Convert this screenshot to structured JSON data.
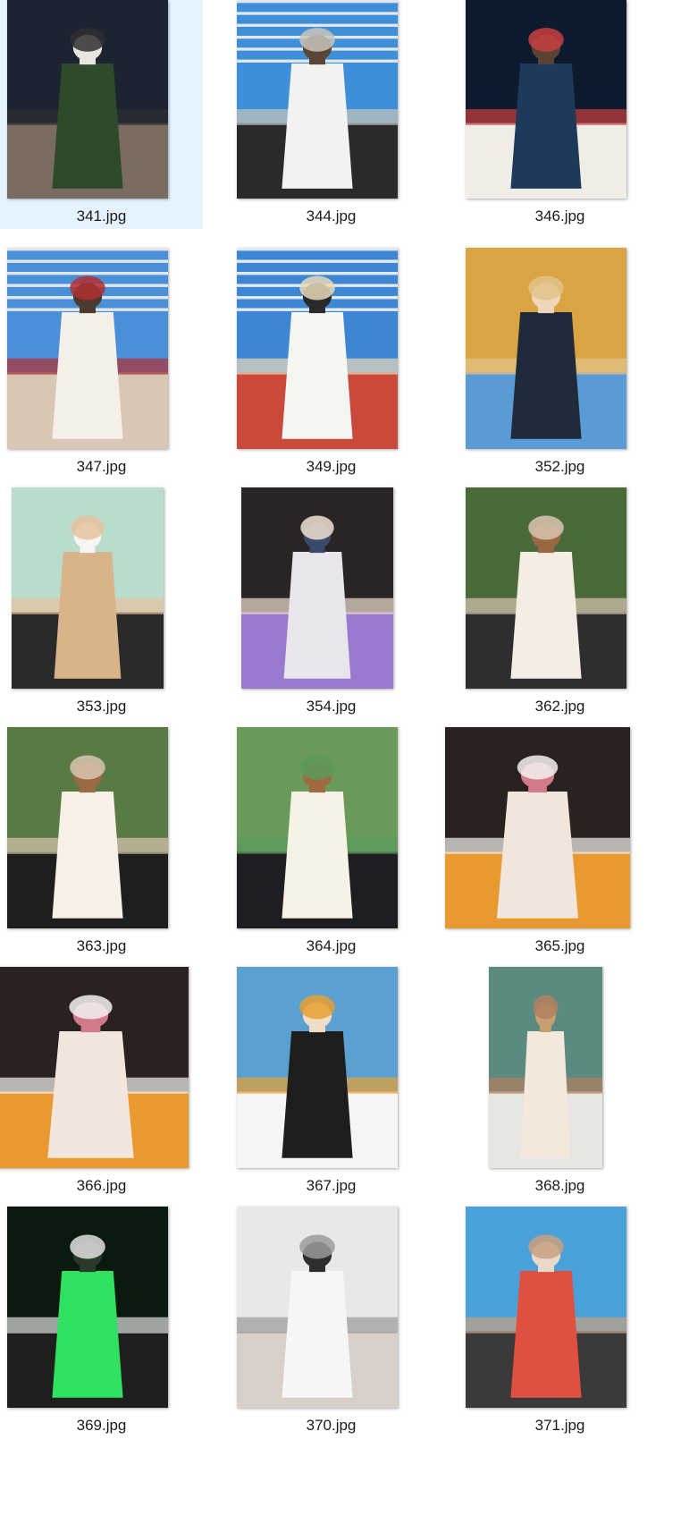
{
  "files": [
    {
      "name": "341.jpg",
      "selected": true,
      "palette": [
        "#1b2430",
        "#2e4a2a",
        "#e8e4de",
        "#7a6c60",
        "#2f2f33"
      ]
    },
    {
      "name": "344.jpg",
      "selected": false,
      "palette": [
        "#3f8fd8",
        "#f2f2f0",
        "#5a4638",
        "#2a2a2a",
        "#c9c4bc"
      ]
    },
    {
      "name": "346.jpg",
      "selected": false,
      "palette": [
        "#0e1a2e",
        "#1e3a5a",
        "#5a4332",
        "#f0ece6",
        "#c84040"
      ]
    },
    {
      "name": "347.jpg",
      "selected": false,
      "palette": [
        "#4a90d9",
        "#f4efe8",
        "#4b3a2e",
        "#d8c7b4",
        "#b03030"
      ]
    },
    {
      "name": "349.jpg",
      "selected": false,
      "palette": [
        "#3d86d4",
        "#f5f5f2",
        "#2a2a2a",
        "#c94a3a",
        "#e8d8b8"
      ]
    },
    {
      "name": "352.jpg",
      "selected": false,
      "palette": [
        "#d9a441",
        "#1f2a3a",
        "#f0d6b8",
        "#5b9bd5",
        "#e0c38a"
      ]
    },
    {
      "name": "353.jpg",
      "selected": false,
      "palette": [
        "#b9dccd",
        "#d9b48a",
        "#f5f5f5",
        "#2a2a2a",
        "#e6c29c"
      ]
    },
    {
      "name": "354.jpg",
      "selected": false,
      "palette": [
        "#2a2424",
        "#e8e6ea",
        "#3a4a6a",
        "#9a7ad0",
        "#f0e0d0"
      ]
    },
    {
      "name": "362.jpg",
      "selected": false,
      "palette": [
        "#4a6a3a",
        "#f5ede4",
        "#9a6840",
        "#2e2e30",
        "#d8c4b0"
      ]
    },
    {
      "name": "363.jpg",
      "selected": false,
      "palette": [
        "#5a7a44",
        "#f6f0e6",
        "#9a6a44",
        "#1e1e1e",
        "#d8c4b0"
      ]
    },
    {
      "name": "364.jpg",
      "selected": false,
      "palette": [
        "#6a9a5a",
        "#f7f2e6",
        "#a06a40",
        "#1e1e22",
        "#5a9a5a"
      ]
    },
    {
      "name": "365.jpg",
      "selected": false,
      "palette": [
        "#2a2220",
        "#f2e6dc",
        "#d07a8a",
        "#e89a30",
        "#f5f2ee"
      ]
    },
    {
      "name": "366.jpg",
      "selected": false,
      "palette": [
        "#2a2220",
        "#f2e6dc",
        "#d07a8a",
        "#e89a30",
        "#f5f2ee"
      ]
    },
    {
      "name": "367.jpg",
      "selected": false,
      "palette": [
        "#5aa0d0",
        "#1e1e1e",
        "#f0ddc8",
        "#f5f5f5",
        "#e8a030"
      ]
    },
    {
      "name": "368.jpg",
      "selected": false,
      "palette": [
        "#5a8a80",
        "#f4e8dc",
        "#c8a070",
        "#e8e6e2",
        "#b08060"
      ]
    },
    {
      "name": "369.jpg",
      "selected": false,
      "palette": [
        "#0a1a0e",
        "#30e060",
        "#2a3a2a",
        "#1e1e1e",
        "#e0e0e0"
      ]
    },
    {
      "name": "370.jpg",
      "selected": false,
      "palette": [
        "#e8e8ea",
        "#f6f6f6",
        "#2e2e2e",
        "#d8d0c8",
        "#9a9a9a"
      ]
    },
    {
      "name": "371.jpg",
      "selected": false,
      "palette": [
        "#4aa0d8",
        "#e05040",
        "#e8d8c8",
        "#3a3a3a",
        "#c8a080"
      ]
    }
  ]
}
